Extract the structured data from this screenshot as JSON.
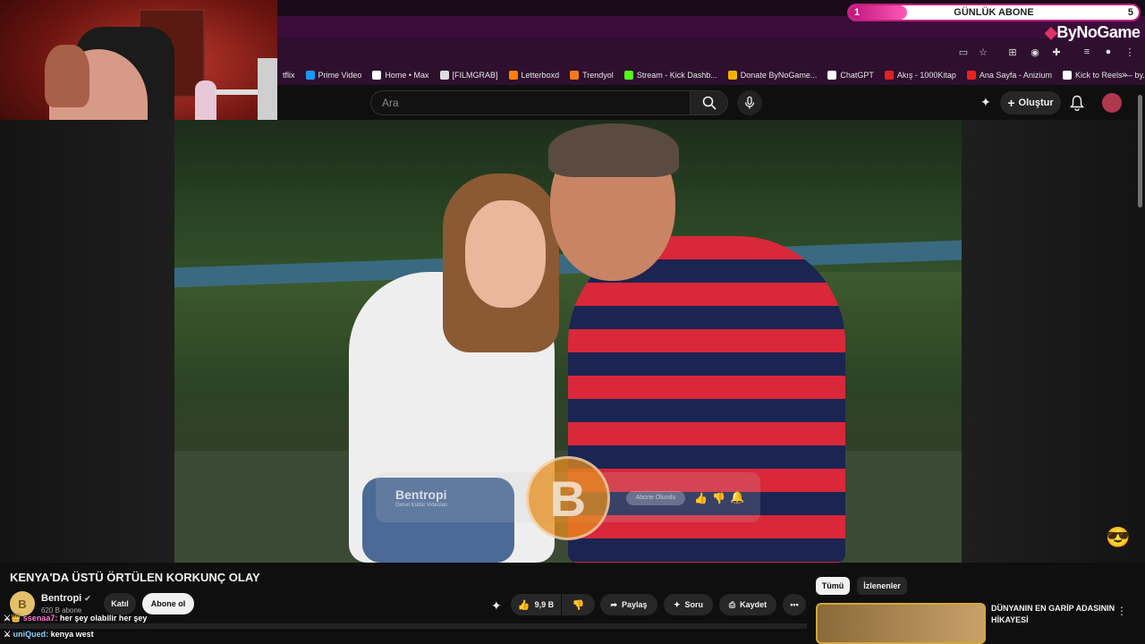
{
  "overlay": {
    "sub_goal_current": "1",
    "sub_goal_title": "GÜNLÜK ABONE",
    "sub_goal_target": "5",
    "sub_goal_progress": 0.2,
    "brand": "ByNoGame"
  },
  "bookmarks": [
    {
      "label": "tflix",
      "color": "#e50914"
    },
    {
      "label": "Prime Video",
      "color": "#1a98ff"
    },
    {
      "label": "Home • Max",
      "color": "#ffffff"
    },
    {
      "label": "[FILMGRAB]",
      "color": "#dddddd"
    },
    {
      "label": "Letterboxd",
      "color": "#ff8000"
    },
    {
      "label": "Trendyol",
      "color": "#f27a1a"
    },
    {
      "label": "Stream - Kick Dashb...",
      "color": "#53fc18"
    },
    {
      "label": "Donate ByNoGame...",
      "color": "#f0b400"
    },
    {
      "label": "ChatGPT",
      "color": "#ffffff"
    },
    {
      "label": "Akış - 1000Kitap",
      "color": "#d22"
    },
    {
      "label": "Ana Sayfa - Anizium",
      "color": "#e22"
    },
    {
      "label": "Kick to Reels — by...",
      "color": "#ffffff"
    }
  ],
  "youtube": {
    "search_placeholder": "Ara",
    "create_label": "Oluştur"
  },
  "watermark": {
    "channel": "Bentropi",
    "tagline": "Genel Kültür Videoları",
    "logo_letter": "B",
    "button": "Abone Olundu"
  },
  "video": {
    "title": "KENYA'DA ÜSTÜ ÖRTÜLEN KORKUNÇ OLAY",
    "channel_name": "Bentropi",
    "channel_subs": "620 B abone",
    "join_label": "Katıl",
    "subscribe_label": "Abone ol",
    "likes": "9,9 B",
    "share_label": "Paylaş",
    "ask_label": "Soru",
    "save_label": "Kaydet"
  },
  "sidebar": {
    "chips": [
      "Tümü",
      "İzlenenler"
    ],
    "rec_title": "DÜNYANIN EN GARİP ADASININ HİKAYESİ"
  },
  "chat": [
    {
      "user": "ssenaa7:",
      "message": "her şey olabilir her şey"
    },
    {
      "user": "uniQued:",
      "message": "kenya west"
    }
  ]
}
